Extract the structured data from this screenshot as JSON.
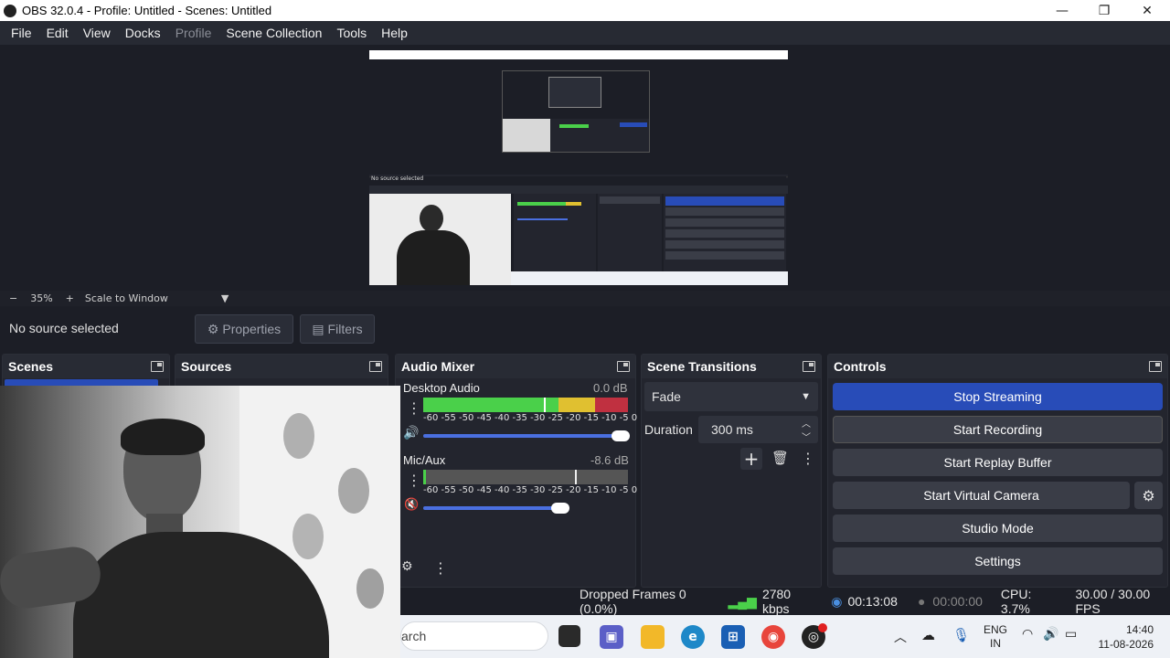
{
  "window": {
    "title": "OBS 32.0.4 - Profile: Untitled - Scenes: Untitled"
  },
  "menu": [
    {
      "label": "File",
      "enabled": true
    },
    {
      "label": "Edit",
      "enabled": true
    },
    {
      "label": "View",
      "enabled": true
    },
    {
      "label": "Docks",
      "enabled": true
    },
    {
      "label": "Profile",
      "enabled": false
    },
    {
      "label": "Scene Collection",
      "enabled": true
    },
    {
      "label": "Tools",
      "enabled": true
    },
    {
      "label": "Help",
      "enabled": true
    }
  ],
  "zoom": {
    "minus": "−",
    "value": "35%",
    "plus": "+",
    "mode": "Scale to Window"
  },
  "context": {
    "no_source": "No source selected",
    "properties": "Properties",
    "filters": "Filters"
  },
  "docks": {
    "scenes": "Scenes",
    "sources": "Sources",
    "audio_mixer": "Audio Mixer",
    "scene_transitions": "Scene Transitions",
    "controls": "Controls"
  },
  "audio": {
    "ticks": "-60 -55 -50 -45 -40 -35 -30 -25 -20 -15 -10 -5 0",
    "channels": [
      {
        "name": "Desktop Audio",
        "db": "0.0 dB",
        "volume": 1.0,
        "muted": false
      },
      {
        "name": "Mic/Aux",
        "db": "-8.6 dB",
        "volume": 0.68,
        "muted": true
      }
    ]
  },
  "transitions": {
    "selected": "Fade",
    "duration_label": "Duration",
    "duration_value": "300 ms"
  },
  "controls": {
    "stop_streaming": "Stop Streaming",
    "start_recording": "Start Recording",
    "start_replay": "Start Replay Buffer",
    "start_virtual_camera": "Start Virtual Camera",
    "studio_mode": "Studio Mode",
    "settings": "Settings"
  },
  "status": {
    "dropped_frames": "Dropped Frames 0 (0.0%)",
    "bitrate": "2780 kbps",
    "stream_time": "00:13:08",
    "rec_time": "00:00:00",
    "cpu": "CPU: 3.7%",
    "fps": "30.00 / 30.00 FPS"
  },
  "taskbar": {
    "search_placeholder": "arch",
    "lang_top": "ENG",
    "lang_bottom": "IN",
    "time": "14:40",
    "date": "11-08-2026"
  },
  "colors": {
    "accent": "#284cb8",
    "bg": "#1c1e26",
    "panel": "#23252e"
  }
}
